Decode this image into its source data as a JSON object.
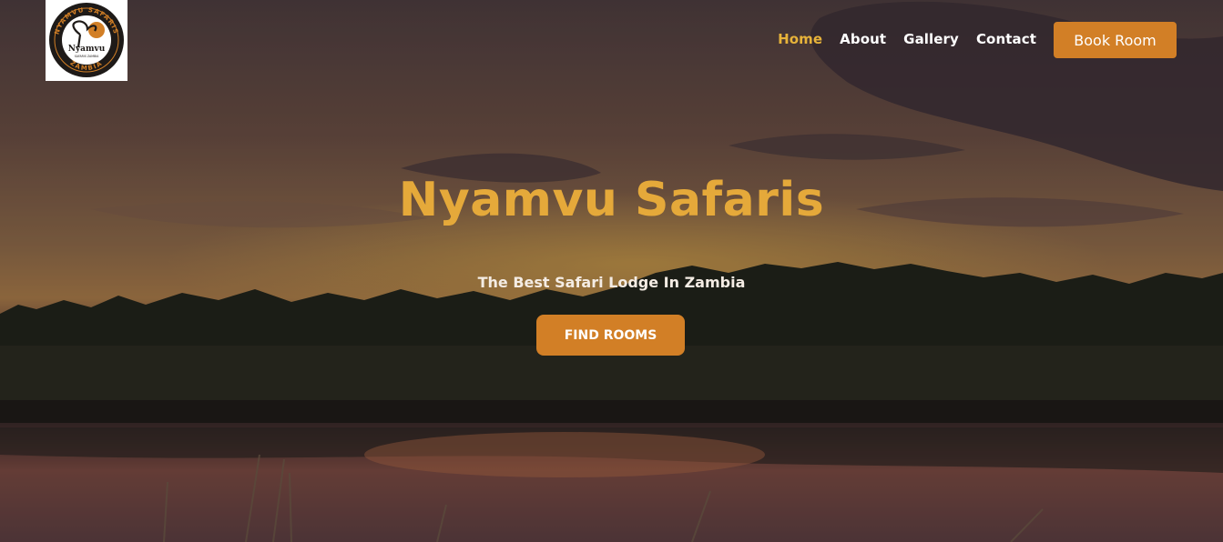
{
  "header": {
    "logo": {
      "name": "Nyamvu",
      "arc_top": "NYAMVU SAFARIS",
      "arc_bottom": "ZAMBIA",
      "small": "SAFARIS ZAMBIA"
    },
    "nav": [
      {
        "label": "Home",
        "active": true
      },
      {
        "label": "About",
        "active": false
      },
      {
        "label": "Gallery",
        "active": false
      },
      {
        "label": "Contact",
        "active": false
      }
    ],
    "book_button": "Book Room"
  },
  "hero": {
    "title": "Nyamvu Safaris",
    "subtitle": "The Best Safari Lodge In Zambia",
    "cta": "FIND ROOMS"
  },
  "colors": {
    "accent": "#d27f26",
    "title": "#e5a93a",
    "nav_active": "#e7b33a",
    "nav_text": "#ffffff"
  }
}
